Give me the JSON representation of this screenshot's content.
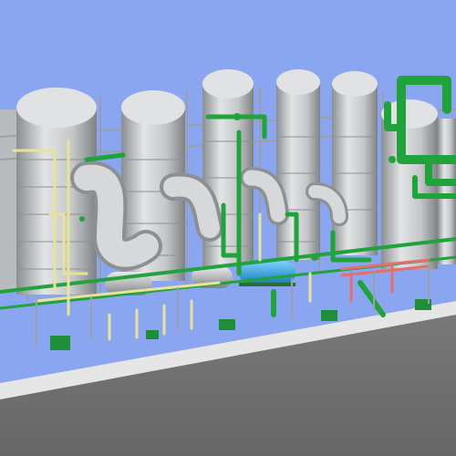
{
  "scene": {
    "subject": "3d-plant-model",
    "colors": {
      "sky": "#8aa6f0",
      "ground": "#6f6f6f",
      "vessel": "#c9cbcd",
      "vessel_shadow": "#8c8f92",
      "green_pipe": "#1fa33a",
      "yellow_pipe": "#e7e39a",
      "blue_tank": "#2aa7e6",
      "red_pipe": "#e66e6e"
    }
  }
}
